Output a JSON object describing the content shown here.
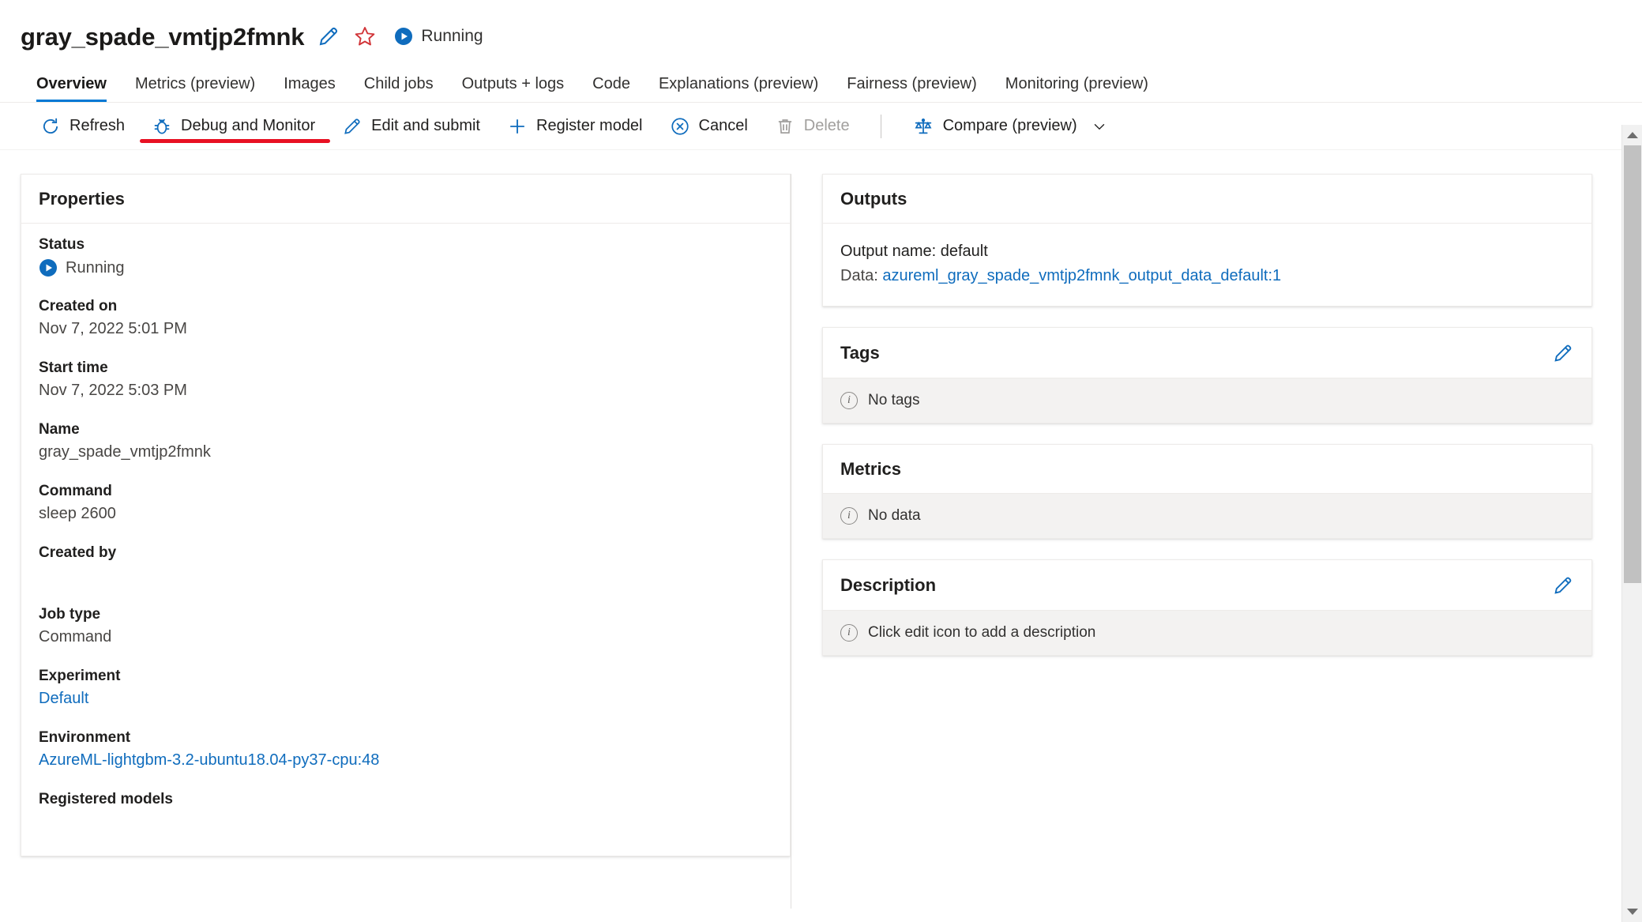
{
  "header": {
    "job_name": "gray_spade_vmtjp2fmnk",
    "edit_icon": "pencil-icon",
    "favorite_icon": "star-icon",
    "status_icon": "running-play-icon",
    "status_label": "Running"
  },
  "tabs": [
    {
      "label": "Overview",
      "active": true
    },
    {
      "label": "Metrics (preview)",
      "active": false
    },
    {
      "label": "Images",
      "active": false
    },
    {
      "label": "Child jobs",
      "active": false
    },
    {
      "label": "Outputs + logs",
      "active": false
    },
    {
      "label": "Code",
      "active": false
    },
    {
      "label": "Explanations (preview)",
      "active": false
    },
    {
      "label": "Fairness (preview)",
      "active": false
    },
    {
      "label": "Monitoring (preview)",
      "active": false
    }
  ],
  "toolbar": {
    "items": [
      {
        "label": "Refresh",
        "icon": "refresh-icon",
        "disabled": false,
        "highlighted": false
      },
      {
        "label": "Debug and Monitor",
        "icon": "bug-icon",
        "disabled": false,
        "highlighted": true
      },
      {
        "label": "Edit and submit",
        "icon": "pencil-icon",
        "disabled": false,
        "highlighted": false
      },
      {
        "label": "Register model",
        "icon": "plus-icon",
        "disabled": false,
        "highlighted": false
      },
      {
        "label": "Cancel",
        "icon": "cancel-circle-icon",
        "disabled": false,
        "highlighted": false
      },
      {
        "label": "Delete",
        "icon": "trash-icon",
        "disabled": true,
        "highlighted": false
      }
    ],
    "compare": {
      "label": "Compare (preview)",
      "icon": "scales-icon",
      "chevron": "chevron-down-icon"
    },
    "highlight_color": "#e81123"
  },
  "properties": {
    "title": "Properties",
    "rows": [
      {
        "label": "Status",
        "value": "Running",
        "type": "status"
      },
      {
        "label": "Created on",
        "value": "Nov 7, 2022 5:01 PM",
        "type": "text"
      },
      {
        "label": "Start time",
        "value": "Nov 7, 2022 5:03 PM",
        "type": "text"
      },
      {
        "label": "Name",
        "value": "gray_spade_vmtjp2fmnk",
        "type": "text"
      },
      {
        "label": "Command",
        "value": "sleep 2600",
        "type": "text"
      },
      {
        "label": "Created by",
        "value": "",
        "type": "text"
      },
      {
        "label": "Job type",
        "value": "Command",
        "type": "text"
      },
      {
        "label": "Experiment",
        "value": "Default",
        "type": "link"
      },
      {
        "label": "Environment",
        "value": "AzureML-lightgbm-3.2-ubuntu18.04-py37-cpu:48",
        "type": "link"
      },
      {
        "label": "Registered models",
        "value": "",
        "type": "text"
      }
    ]
  },
  "outputs": {
    "title": "Outputs",
    "output_name_label": "Output name: default",
    "data_label": "Data: ",
    "data_link": "azureml_gray_spade_vmtjp2fmnk_output_data_default:1"
  },
  "tags": {
    "title": "Tags",
    "empty_text": "No tags",
    "edit_icon": "pencil-icon"
  },
  "metrics": {
    "title": "Metrics",
    "empty_text": "No data"
  },
  "description": {
    "title": "Description",
    "empty_text": "Click edit icon to add a description",
    "edit_icon": "pencil-icon"
  },
  "colors": {
    "accent": "#0078d4",
    "link": "#0f6cbd",
    "highlight": "#e81123",
    "star": "#d13438",
    "empty_bg": "#f3f2f1"
  }
}
